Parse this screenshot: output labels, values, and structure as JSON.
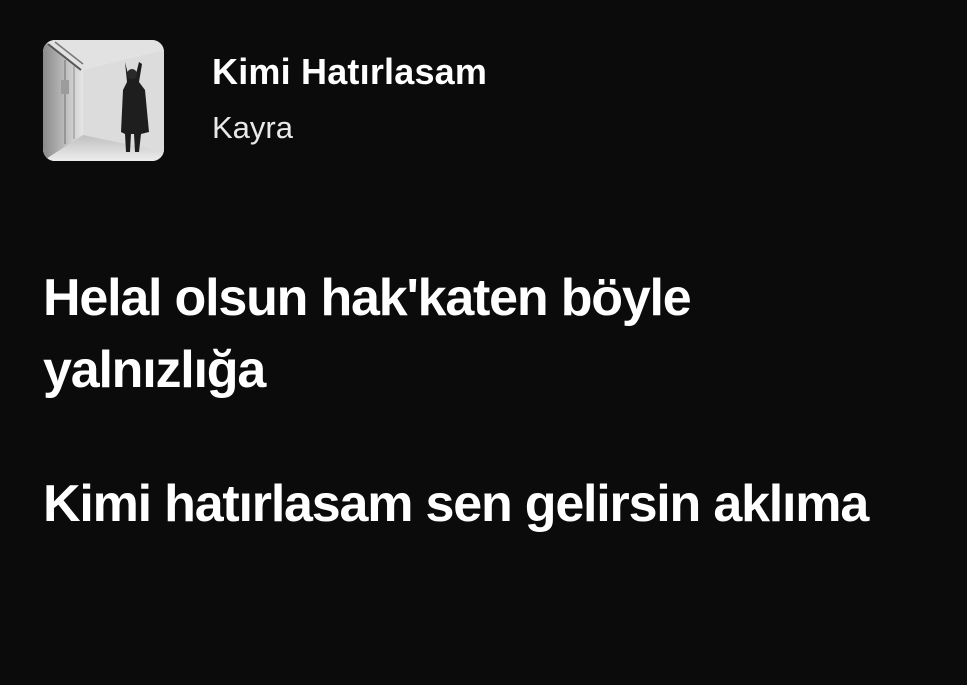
{
  "track": {
    "title": "Kimi Hatırlasam",
    "artist": "Kayra",
    "cover_icon": "album-cover-image"
  },
  "lyrics": {
    "lines": [
      "Helal olsun hak'katen böyle yalnızlığa",
      "Kimi hatırlasam sen gelirsin aklıma"
    ]
  },
  "colors": {
    "background": "#0b0b0b",
    "text_primary": "#ffffff",
    "text_secondary": "#e9e9e9"
  }
}
